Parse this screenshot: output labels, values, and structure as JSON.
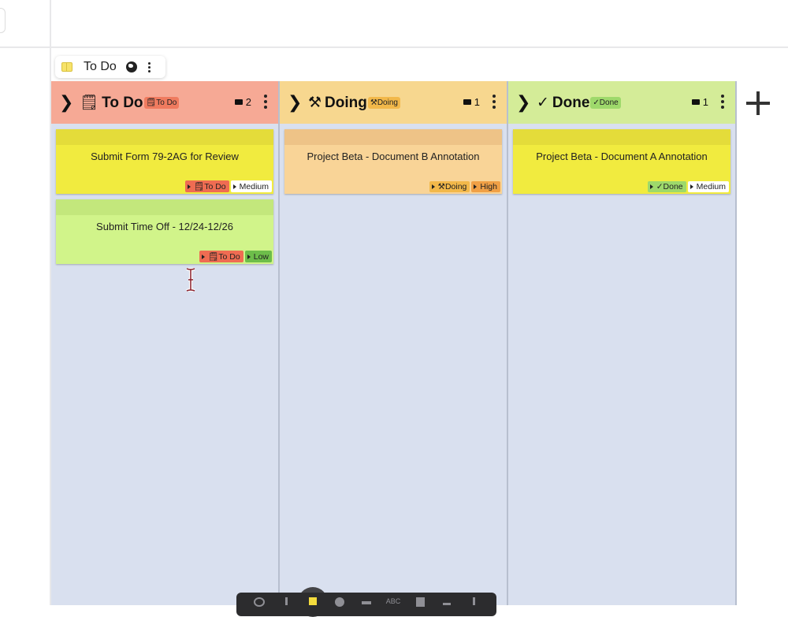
{
  "board": {
    "name": "To Do"
  },
  "columns": [
    {
      "id": "todo",
      "glyph": "🗒",
      "title": "To Do",
      "tag": "🗒To Do",
      "count": "2",
      "cards": [
        {
          "title": "Submit Form 79-2AG for Review",
          "color": "yellow",
          "tags": [
            {
              "label": "🗒To Do",
              "kind": "todo"
            },
            {
              "label": "Medium",
              "kind": "medium"
            }
          ]
        },
        {
          "title": "Submit Time Off - 12/24-12/26",
          "color": "green",
          "tags": [
            {
              "label": "🗒To Do",
              "kind": "todo"
            },
            {
              "label": "Low",
              "kind": "low"
            }
          ]
        }
      ]
    },
    {
      "id": "doing",
      "glyph": "⚒",
      "title": "Doing",
      "tag": "⚒Doing",
      "count": "1",
      "cards": [
        {
          "title": "Project Beta - Document B Annotation",
          "color": "orange",
          "tags": [
            {
              "label": "⚒Doing",
              "kind": "doing"
            },
            {
              "label": "High",
              "kind": "high"
            }
          ]
        }
      ]
    },
    {
      "id": "done",
      "glyph": "✓",
      "title": "Done",
      "tag": "✓Done",
      "count": "1",
      "cards": [
        {
          "title": "Project Beta - Document A Annotation",
          "color": "yellow",
          "tags": [
            {
              "label": "✓Done",
              "kind": "done"
            },
            {
              "label": "Medium",
              "kind": "medium"
            }
          ]
        }
      ]
    }
  ],
  "colors": {
    "todo_header": "#f6a995",
    "doing_header": "#f7d78f",
    "done_header": "#d4ec98",
    "column_bg": "#d9e0ef",
    "card_yellow": "#f1eb3f",
    "card_green": "#d1f48a",
    "card_orange": "#f9d497"
  },
  "icons": {
    "chevron": "chevron-right-icon",
    "board": "board-icon",
    "visibility": "globe-icon",
    "menu": "kebab-menu-icon",
    "add": "plus-icon",
    "count": "card-count-icon"
  },
  "toolbar": {
    "tools": [
      "lasso-icon",
      "pen-icon",
      "sticky-note-icon",
      "shape-icon",
      "arrow-icon",
      "text-icon",
      "clipboard-icon",
      "plus-icon",
      "more-icon"
    ],
    "text_tool_label": "ABC"
  }
}
